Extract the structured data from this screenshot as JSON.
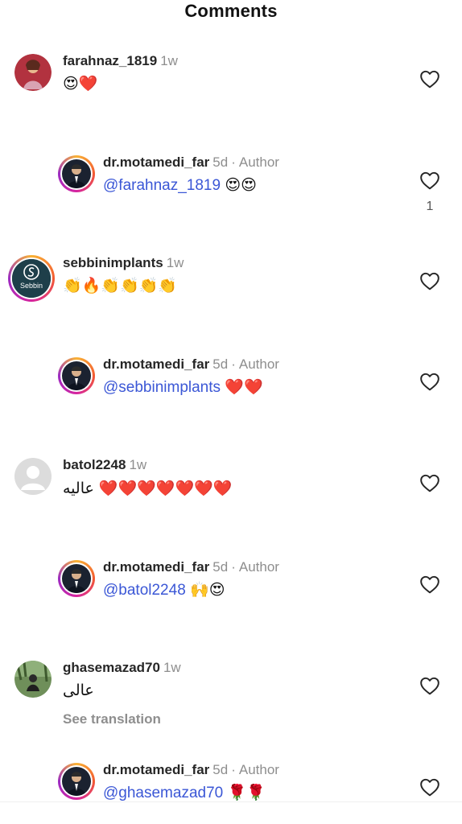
{
  "header": {
    "title": "Comments"
  },
  "comments": [
    {
      "username": "farahnaz_1819",
      "time": "1w",
      "text": "😍❤️",
      "reply": {
        "username": "dr.motamedi_far",
        "time": "5d",
        "author_label": "Author",
        "mention": "@farahnaz_1819",
        "text": "😍😍",
        "likes": "1"
      }
    },
    {
      "username": "sebbinimplants",
      "time": "1w",
      "text": "👏🔥👏👏👏👏",
      "avatar_text": "Sebbin",
      "reply": {
        "username": "dr.motamedi_far",
        "time": "5d",
        "author_label": "Author",
        "mention": "@sebbinimplants",
        "text": "❤️❤️"
      }
    },
    {
      "username": "batol2248",
      "time": "1w",
      "text": "عالیه ❤️❤️❤️❤️❤️❤️❤️",
      "reply": {
        "username": "dr.motamedi_far",
        "time": "5d",
        "author_label": "Author",
        "mention": "@batol2248",
        "text": "🙌😍"
      }
    },
    {
      "username": "ghasemazad70",
      "time": "1w",
      "text": "عالی",
      "see_translation": "See translation",
      "reply": {
        "username": "dr.motamedi_far",
        "time": "5d",
        "author_label": "Author",
        "mention": "@ghasemazad70",
        "text": "🌹🌹"
      }
    }
  ],
  "separator": "·",
  "colors": {
    "mention": "#3b57d6",
    "muted": "#8e8e8e",
    "heart_stroke": "#262626"
  }
}
